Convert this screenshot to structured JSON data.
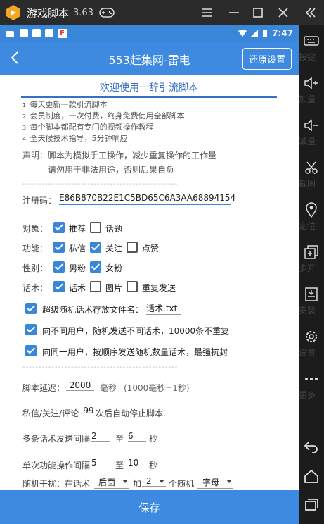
{
  "window": {
    "title": "游戏脚本",
    "version": "3.63"
  },
  "statusbar": {
    "time": "7:47"
  },
  "appbar": {
    "title": "553赶集网-雷电",
    "reset_label": "还原设置"
  },
  "welcome": "欢迎使用一辞引流脚本",
  "features": [
    {
      "num": "1.",
      "text": "每天更新一款引流脚本"
    },
    {
      "num": "2.",
      "text": "会员制度，一次付费，终身免费使用全部脚本"
    },
    {
      "num": "3.",
      "text": "每个脚本都配有专门的视频操作教程"
    },
    {
      "num": "4.",
      "text": "全天候技术指导，5分钟响应"
    }
  ],
  "disclaimer": {
    "line1": "声明：脚本为模拟手工操作，减少重复操作的工作量",
    "line2": "请勿用于非法用途，否则后果自负"
  },
  "divider": "------------------------------------------------",
  "registration": {
    "label": "注册码：",
    "value": "E86B870B22E1C5BD65C6A3AA68894154"
  },
  "rows": {
    "target": {
      "label": "对象：",
      "opt1": "推荐",
      "opt2": "话题"
    },
    "function": {
      "label": "功能：",
      "opt1": "私信",
      "opt2": "关注",
      "opt3": "点赞"
    },
    "gender": {
      "label": "性别：",
      "opt1": "男粉",
      "opt2": "女粉"
    },
    "script": {
      "label": "话术：",
      "opt1": "话术",
      "opt2": "图片",
      "opt3": "重复发送"
    }
  },
  "super_random": {
    "label": "超级随机话术存放文件名：",
    "value": "话术.txt"
  },
  "diff_users": "向不同用户，随机发送不同话术，10000条不重复",
  "same_user": "向同一用户，按顺序发送随机数量话术，最强抗封",
  "delay": {
    "label": "脚本延迟：",
    "value": "2000",
    "unit": "毫秒",
    "hint": "(1000毫秒=1秒)"
  },
  "stop_after": {
    "prefix": "私信/关注/评论",
    "value": "99",
    "suffix": "次后自动停止脚本."
  },
  "multi_interval": {
    "label": "多条话术发送间隔",
    "from": "2",
    "to_label": "至",
    "to": "6",
    "unit": "秒"
  },
  "single_interval": {
    "label": "单次功能操作间隔",
    "from": "5",
    "to_label": "至",
    "to": "10",
    "unit": "秒"
  },
  "random_interfere": {
    "label": "随机干扰：在话术",
    "pos": "后面",
    "add": "加",
    "count": "2",
    "mid": "个随机",
    "type": "字母"
  },
  "save_label": "保存",
  "sidebar": [
    {
      "label": "按键",
      "icon": "keyboard-icon"
    },
    {
      "label": "加量",
      "icon": "volume-up-icon"
    },
    {
      "label": "减量",
      "icon": "volume-down-icon"
    },
    {
      "label": "截图",
      "icon": "scissors-icon"
    },
    {
      "label": "定位",
      "icon": "location-icon"
    },
    {
      "label": "多开",
      "icon": "multi-open-icon"
    },
    {
      "label": "安装",
      "icon": "apk-icon"
    },
    {
      "label": "设置",
      "icon": "gear-icon"
    },
    {
      "label": "更多",
      "icon": "more-icon"
    }
  ]
}
